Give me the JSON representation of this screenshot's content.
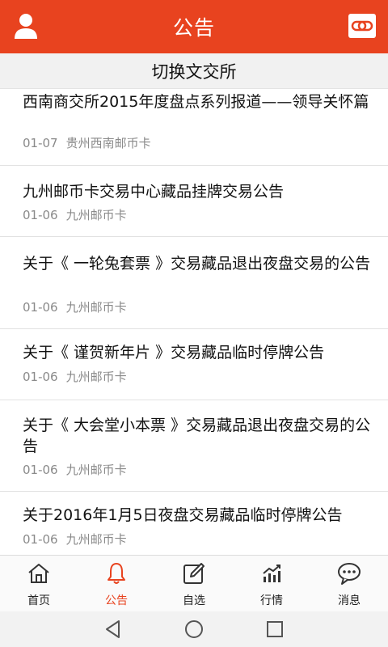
{
  "header": {
    "title": "公告",
    "left_icon": "user-icon",
    "right_icon": "link-icon",
    "accent_color": "#e8431f"
  },
  "switch_bar": {
    "label": "切换文交所"
  },
  "announcements": [
    {
      "title": "西南商交所2015年度盘点系列报道——领导关怀篇",
      "date": "01-07",
      "source": "贵州西南邮币卡"
    },
    {
      "title": "九州邮币卡交易中心藏品挂牌交易公告",
      "date": "01-06",
      "source": "九州邮币卡"
    },
    {
      "title": "关于《 一轮兔套票 》交易藏品退出夜盘交易的公告",
      "date": "01-06",
      "source": "九州邮币卡"
    },
    {
      "title": "关于《 谨贺新年片 》交易藏品临时停牌公告",
      "date": "01-06",
      "source": "九州邮币卡"
    },
    {
      "title": "关于《 大会堂小本票 》交易藏品退出夜盘交易的公告",
      "date": "01-06",
      "source": "九州邮币卡"
    },
    {
      "title": "关于2016年1月5日夜盘交易藏品临时停牌公告",
      "date": "01-06",
      "source": "九州邮币卡"
    }
  ],
  "bottom_nav": {
    "items": [
      {
        "label": "首页",
        "icon": "home-icon",
        "active": false
      },
      {
        "label": "公告",
        "icon": "bell-icon",
        "active": true
      },
      {
        "label": "自选",
        "icon": "edit-icon",
        "active": false
      },
      {
        "label": "行情",
        "icon": "chart-icon",
        "active": false
      },
      {
        "label": "消息",
        "icon": "chat-icon",
        "active": false
      }
    ]
  },
  "system_nav": {
    "buttons": [
      "back-icon",
      "home-circle-icon",
      "recent-apps-icon"
    ]
  }
}
